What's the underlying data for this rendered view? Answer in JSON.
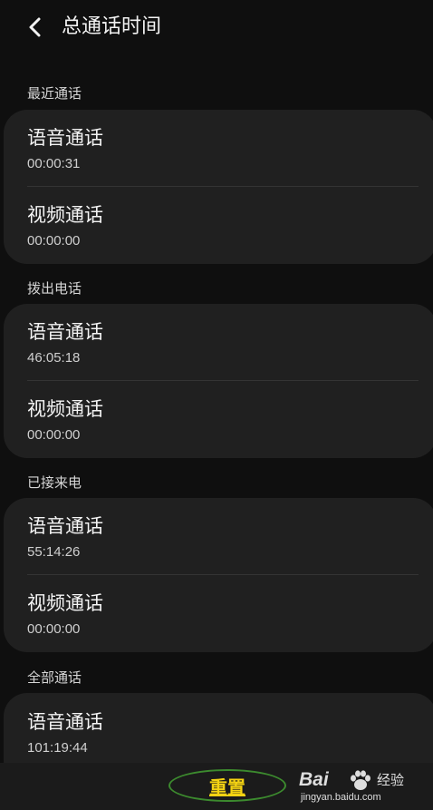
{
  "header": {
    "title": "总通话时间",
    "back_icon": "chevron-left-icon"
  },
  "sections": [
    {
      "label": "最近通话",
      "rows": [
        {
          "title": "语音通话",
          "value": "00:00:31"
        },
        {
          "title": "视频通话",
          "value": "00:00:00"
        }
      ]
    },
    {
      "label": "拨出电话",
      "rows": [
        {
          "title": "语音通话",
          "value": "46:05:18"
        },
        {
          "title": "视频通话",
          "value": "00:00:00"
        }
      ]
    },
    {
      "label": "已接来电",
      "rows": [
        {
          "title": "语音通话",
          "value": "55:14:26"
        },
        {
          "title": "视频通话",
          "value": "00:00:00"
        }
      ]
    },
    {
      "label": "全部通话",
      "rows": [
        {
          "title": "语音通话",
          "value": "101:19:44"
        }
      ]
    }
  ],
  "bottom_bar": {
    "reset_label": "重置"
  },
  "watermark": {
    "brand": "Bai",
    "brand_icon": "paw-icon",
    "suffix": "经验",
    "url": "jingyan.baidu.com"
  },
  "colors": {
    "background": "#0f0f0f",
    "card": "#202020",
    "accent": "#f4d312",
    "highlight_ring": "#3c8a2e"
  }
}
